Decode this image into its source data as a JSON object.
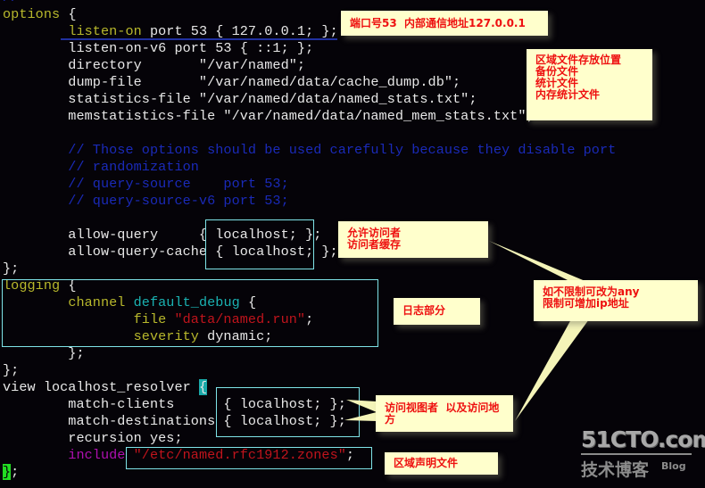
{
  "code_lines": [
    {
      "segments": [
        {
          "t": "//",
          "c": "cm"
        }
      ]
    },
    {
      "segments": [
        {
          "t": "options",
          "c": "kw"
        },
        {
          "t": " {",
          "c": ""
        }
      ]
    },
    {
      "segments": [
        {
          "t": "        ",
          "c": ""
        },
        {
          "t": "listen-on",
          "c": "kw"
        },
        {
          "t": " port 53 { 127.0.0.1; };",
          "c": ""
        }
      ]
    },
    {
      "segments": [
        {
          "t": "        listen-on-v6 port 53 { ::1; };",
          "c": ""
        }
      ]
    },
    {
      "segments": [
        {
          "t": "        directory       \"/var/named\";",
          "c": ""
        }
      ]
    },
    {
      "segments": [
        {
          "t": "        dump-file       \"/var/named/data/cache_dump.db\";",
          "c": ""
        }
      ]
    },
    {
      "segments": [
        {
          "t": "        statistics-file \"/var/named/data/named_stats.txt\";",
          "c": ""
        }
      ]
    },
    {
      "segments": [
        {
          "t": "        memstatistics-file \"/var/named/data/named_mem_stats.txt\";",
          "c": ""
        }
      ]
    },
    {
      "segments": [
        {
          "t": "",
          "c": ""
        }
      ]
    },
    {
      "segments": [
        {
          "t": "        // Those options should be used carefully because they disable port",
          "c": "cm"
        }
      ]
    },
    {
      "segments": [
        {
          "t": "        // randomization",
          "c": "cm"
        }
      ]
    },
    {
      "segments": [
        {
          "t": "        // query-source    port 53;",
          "c": "cm"
        }
      ]
    },
    {
      "segments": [
        {
          "t": "        // query-source-v6 port 53;",
          "c": "cm"
        }
      ]
    },
    {
      "segments": [
        {
          "t": "",
          "c": ""
        }
      ]
    },
    {
      "segments": [
        {
          "t": "        allow-query     { localhost; };",
          "c": ""
        }
      ]
    },
    {
      "segments": [
        {
          "t": "        allow-query-cache { localhost; };",
          "c": ""
        }
      ]
    },
    {
      "segments": [
        {
          "t": "};",
          "c": ""
        }
      ]
    },
    {
      "segments": [
        {
          "t": "logging",
          "c": "kw"
        },
        {
          "t": " {",
          "c": ""
        }
      ]
    },
    {
      "segments": [
        {
          "t": "        ",
          "c": ""
        },
        {
          "t": "channel",
          "c": "kw"
        },
        {
          "t": " ",
          "c": ""
        },
        {
          "t": "default_debug",
          "c": "cyan"
        },
        {
          "t": " {",
          "c": ""
        }
      ]
    },
    {
      "segments": [
        {
          "t": "                ",
          "c": ""
        },
        {
          "t": "file",
          "c": "kw"
        },
        {
          "t": " ",
          "c": ""
        },
        {
          "t": "\"data/named.run\"",
          "c": "str"
        },
        {
          "t": ";",
          "c": ""
        }
      ]
    },
    {
      "segments": [
        {
          "t": "                ",
          "c": ""
        },
        {
          "t": "severity",
          "c": "kw"
        },
        {
          "t": " dynamic;",
          "c": ""
        }
      ]
    },
    {
      "segments": [
        {
          "t": "        };",
          "c": ""
        }
      ]
    },
    {
      "segments": [
        {
          "t": "};",
          "c": ""
        }
      ]
    },
    {
      "segments": [
        {
          "t": "view localhost_resolver ",
          "c": ""
        },
        {
          "t": "{",
          "c": "cur-cyan"
        }
      ]
    },
    {
      "segments": [
        {
          "t": "        match-clients      { localhost; };",
          "c": ""
        }
      ]
    },
    {
      "segments": [
        {
          "t": "        match-destinations { localhost; };",
          "c": ""
        }
      ]
    },
    {
      "segments": [
        {
          "t": "        recursion yes;",
          "c": ""
        }
      ]
    },
    {
      "segments": [
        {
          "t": "        ",
          "c": ""
        },
        {
          "t": "include",
          "c": "mag"
        },
        {
          "t": " ",
          "c": ""
        },
        {
          "t": "\"/etc/named.rfc1912.zones\"",
          "c": "str"
        },
        {
          "t": ";",
          "c": ""
        }
      ]
    },
    {
      "segments": [
        {
          "t": "}",
          "c": "cur-green"
        },
        {
          "t": ";",
          "c": ""
        }
      ]
    }
  ],
  "annotations": {
    "port": "端口号53  内部通信地址127.0.0.1",
    "files": "区域文件存放位置\n备份文件\n统计文件\n内存统计文件",
    "allow": "允许访问者\n访问者缓存",
    "logging": "日志部分",
    "any": "如不限制可改为any\n限制可增加ip地址",
    "view": "访问视图者  以及访问地\n方",
    "zones": "区域声明文件"
  },
  "watermark": {
    "site": "51CTO.com",
    "sub": "技术博客",
    "blog": "Blog"
  },
  "colors": {
    "background": "#050308",
    "note_bg": "#ffffcc",
    "note_text": "#ee1010",
    "highlight_box": "#7fe3e8"
  }
}
